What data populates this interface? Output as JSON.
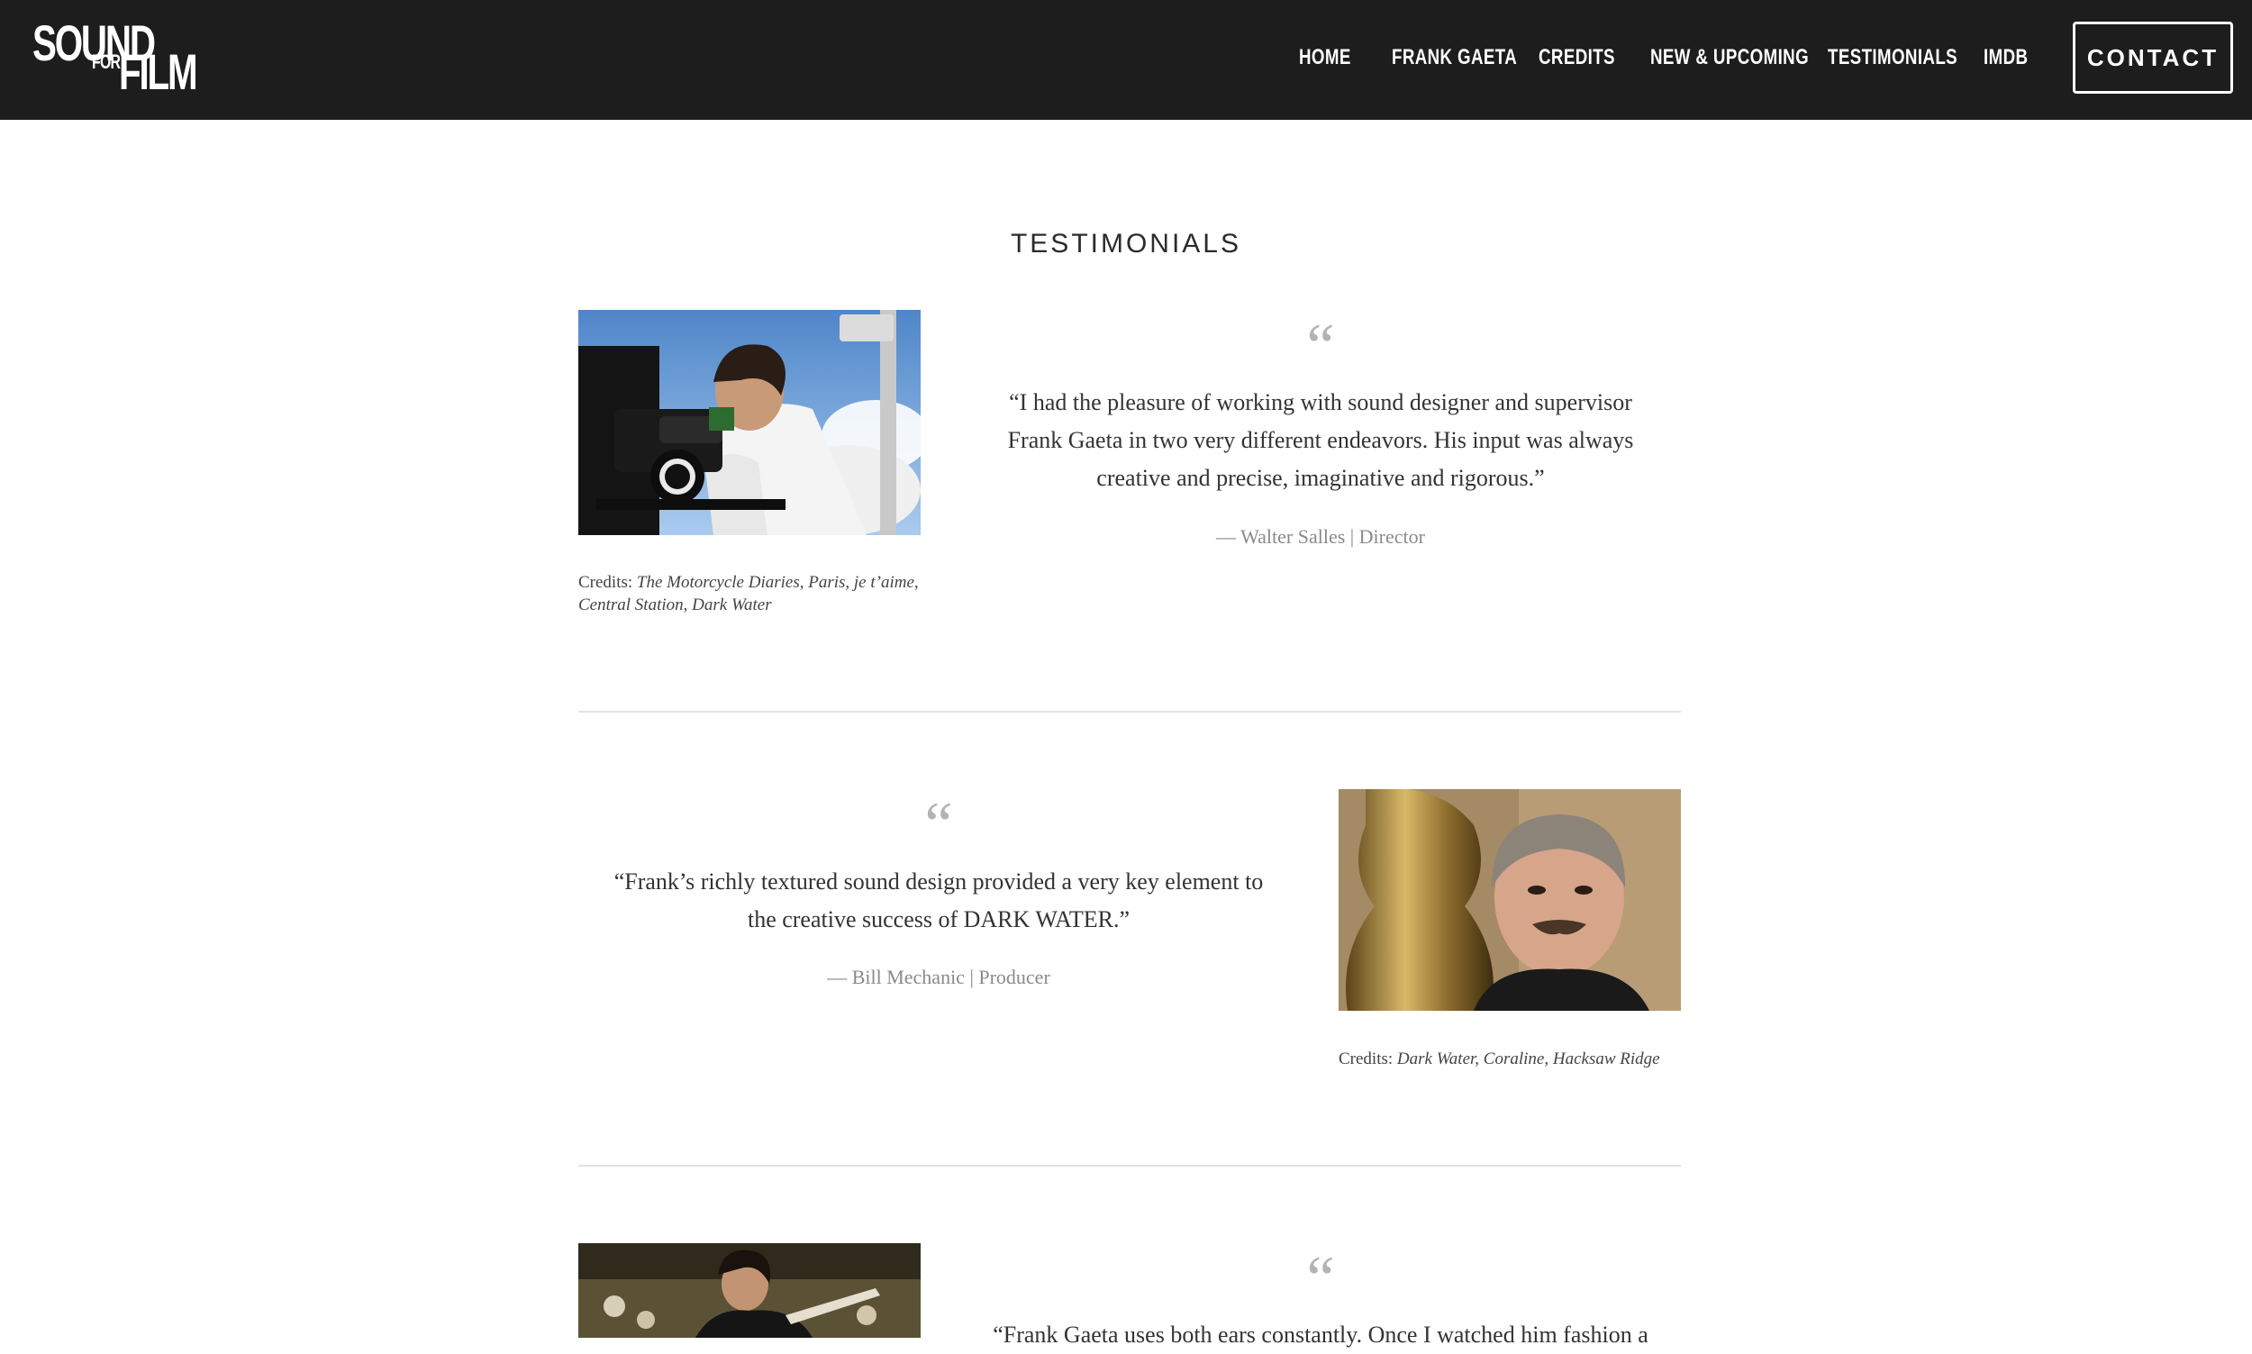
{
  "logo": {
    "line1": "SOUND",
    "line2": "FOR",
    "line3": "FILM"
  },
  "nav": {
    "items": [
      {
        "label": "HOME"
      },
      {
        "label": "FRANK GAETA"
      },
      {
        "label": "CREDITS"
      },
      {
        "label": "NEW & UPCOMING"
      },
      {
        "label": "TESTIMONIALS"
      },
      {
        "label": "IMDB"
      }
    ],
    "contact_label": "CONTACT"
  },
  "page": {
    "title": "TESTIMONIALS"
  },
  "testimonials": [
    {
      "quote": "“I had the pleasure of working with sound designer and supervisor Frank Gaeta in two very different endeavors. His input was always creative and precise, imaginative and rigorous.”",
      "attribution": "— Walter Salles | Director",
      "credits_prefix": "Credits: ",
      "credits_titles": "The Motorcycle Diaries, Paris, je t’aime, Central Station, Dark Water",
      "quote_mark": "“"
    },
    {
      "quote": "“Frank’s richly textured sound design provided a very key element to the creative success of DARK WATER.”",
      "attribution": "— Bill Mechanic | Producer",
      "credits_prefix": "Credits: ",
      "credits_titles": "Dark Water, Coraline, Hacksaw Ridge",
      "quote_mark": "“"
    },
    {
      "quote": "“Frank Gaeta uses both ears constantly. Once I watched him fashion a",
      "quote_mark": "“"
    }
  ]
}
